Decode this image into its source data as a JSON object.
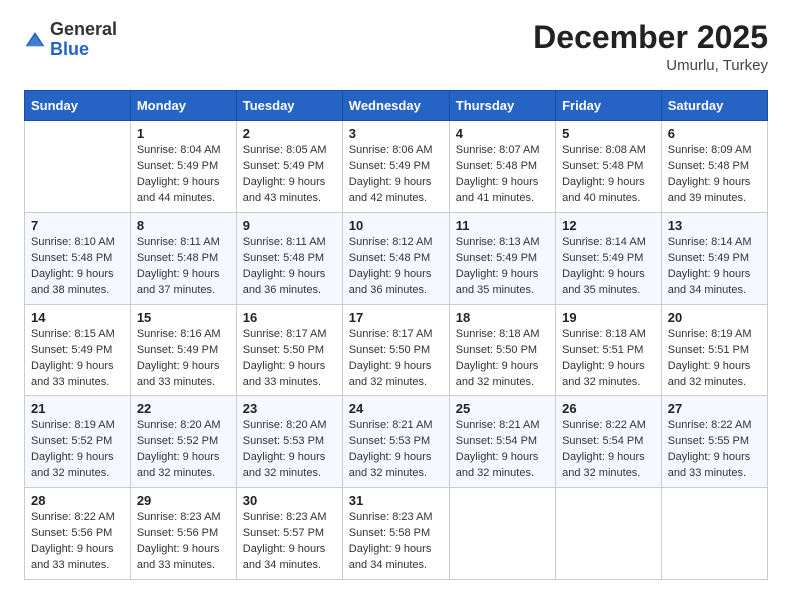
{
  "header": {
    "logo_general": "General",
    "logo_blue": "Blue",
    "month_title": "December 2025",
    "location": "Umurlu, Turkey"
  },
  "days_of_week": [
    "Sunday",
    "Monday",
    "Tuesday",
    "Wednesday",
    "Thursday",
    "Friday",
    "Saturday"
  ],
  "weeks": [
    [
      {
        "day": "",
        "content": ""
      },
      {
        "day": "1",
        "content": "Sunrise: 8:04 AM\nSunset: 5:49 PM\nDaylight: 9 hours\nand 44 minutes."
      },
      {
        "day": "2",
        "content": "Sunrise: 8:05 AM\nSunset: 5:49 PM\nDaylight: 9 hours\nand 43 minutes."
      },
      {
        "day": "3",
        "content": "Sunrise: 8:06 AM\nSunset: 5:49 PM\nDaylight: 9 hours\nand 42 minutes."
      },
      {
        "day": "4",
        "content": "Sunrise: 8:07 AM\nSunset: 5:48 PM\nDaylight: 9 hours\nand 41 minutes."
      },
      {
        "day": "5",
        "content": "Sunrise: 8:08 AM\nSunset: 5:48 PM\nDaylight: 9 hours\nand 40 minutes."
      },
      {
        "day": "6",
        "content": "Sunrise: 8:09 AM\nSunset: 5:48 PM\nDaylight: 9 hours\nand 39 minutes."
      }
    ],
    [
      {
        "day": "7",
        "content": "Sunrise: 8:10 AM\nSunset: 5:48 PM\nDaylight: 9 hours\nand 38 minutes."
      },
      {
        "day": "8",
        "content": "Sunrise: 8:11 AM\nSunset: 5:48 PM\nDaylight: 9 hours\nand 37 minutes."
      },
      {
        "day": "9",
        "content": "Sunrise: 8:11 AM\nSunset: 5:48 PM\nDaylight: 9 hours\nand 36 minutes."
      },
      {
        "day": "10",
        "content": "Sunrise: 8:12 AM\nSunset: 5:48 PM\nDaylight: 9 hours\nand 36 minutes."
      },
      {
        "day": "11",
        "content": "Sunrise: 8:13 AM\nSunset: 5:49 PM\nDaylight: 9 hours\nand 35 minutes."
      },
      {
        "day": "12",
        "content": "Sunrise: 8:14 AM\nSunset: 5:49 PM\nDaylight: 9 hours\nand 35 minutes."
      },
      {
        "day": "13",
        "content": "Sunrise: 8:14 AM\nSunset: 5:49 PM\nDaylight: 9 hours\nand 34 minutes."
      }
    ],
    [
      {
        "day": "14",
        "content": "Sunrise: 8:15 AM\nSunset: 5:49 PM\nDaylight: 9 hours\nand 33 minutes."
      },
      {
        "day": "15",
        "content": "Sunrise: 8:16 AM\nSunset: 5:49 PM\nDaylight: 9 hours\nand 33 minutes."
      },
      {
        "day": "16",
        "content": "Sunrise: 8:17 AM\nSunset: 5:50 PM\nDaylight: 9 hours\nand 33 minutes."
      },
      {
        "day": "17",
        "content": "Sunrise: 8:17 AM\nSunset: 5:50 PM\nDaylight: 9 hours\nand 32 minutes."
      },
      {
        "day": "18",
        "content": "Sunrise: 8:18 AM\nSunset: 5:50 PM\nDaylight: 9 hours\nand 32 minutes."
      },
      {
        "day": "19",
        "content": "Sunrise: 8:18 AM\nSunset: 5:51 PM\nDaylight: 9 hours\nand 32 minutes."
      },
      {
        "day": "20",
        "content": "Sunrise: 8:19 AM\nSunset: 5:51 PM\nDaylight: 9 hours\nand 32 minutes."
      }
    ],
    [
      {
        "day": "21",
        "content": "Sunrise: 8:19 AM\nSunset: 5:52 PM\nDaylight: 9 hours\nand 32 minutes."
      },
      {
        "day": "22",
        "content": "Sunrise: 8:20 AM\nSunset: 5:52 PM\nDaylight: 9 hours\nand 32 minutes."
      },
      {
        "day": "23",
        "content": "Sunrise: 8:20 AM\nSunset: 5:53 PM\nDaylight: 9 hours\nand 32 minutes."
      },
      {
        "day": "24",
        "content": "Sunrise: 8:21 AM\nSunset: 5:53 PM\nDaylight: 9 hours\nand 32 minutes."
      },
      {
        "day": "25",
        "content": "Sunrise: 8:21 AM\nSunset: 5:54 PM\nDaylight: 9 hours\nand 32 minutes."
      },
      {
        "day": "26",
        "content": "Sunrise: 8:22 AM\nSunset: 5:54 PM\nDaylight: 9 hours\nand 32 minutes."
      },
      {
        "day": "27",
        "content": "Sunrise: 8:22 AM\nSunset: 5:55 PM\nDaylight: 9 hours\nand 33 minutes."
      }
    ],
    [
      {
        "day": "28",
        "content": "Sunrise: 8:22 AM\nSunset: 5:56 PM\nDaylight: 9 hours\nand 33 minutes."
      },
      {
        "day": "29",
        "content": "Sunrise: 8:23 AM\nSunset: 5:56 PM\nDaylight: 9 hours\nand 33 minutes."
      },
      {
        "day": "30",
        "content": "Sunrise: 8:23 AM\nSunset: 5:57 PM\nDaylight: 9 hours\nand 34 minutes."
      },
      {
        "day": "31",
        "content": "Sunrise: 8:23 AM\nSunset: 5:58 PM\nDaylight: 9 hours\nand 34 minutes."
      },
      {
        "day": "",
        "content": ""
      },
      {
        "day": "",
        "content": ""
      },
      {
        "day": "",
        "content": ""
      }
    ]
  ]
}
